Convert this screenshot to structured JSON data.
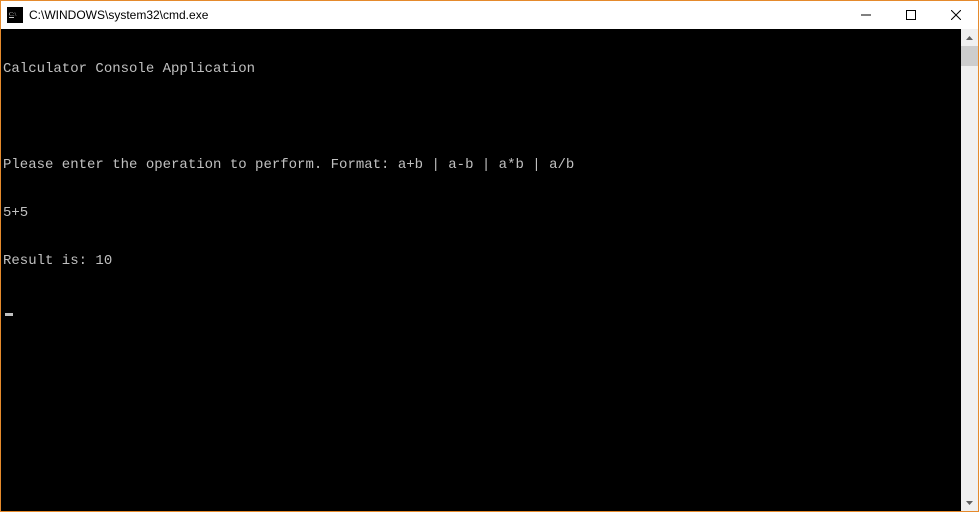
{
  "window": {
    "title": "C:\\WINDOWS\\system32\\cmd.exe"
  },
  "console": {
    "lines": [
      "Calculator Console Application",
      "",
      "Please enter the operation to perform. Format: a+b | a-b | a*b | a/b",
      "5+5",
      "Result is: 10"
    ]
  }
}
